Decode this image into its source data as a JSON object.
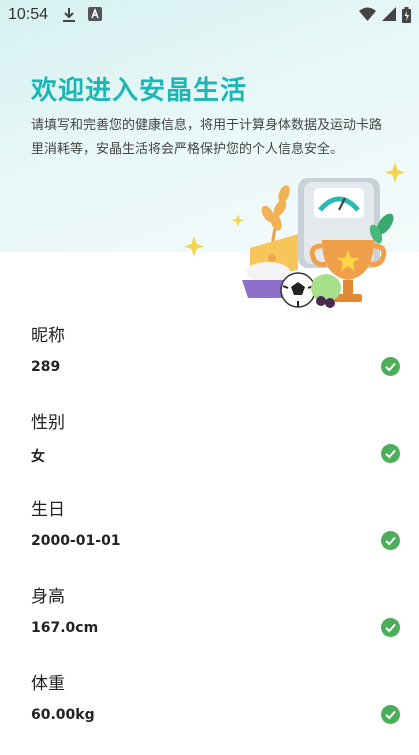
{
  "status_bar": {
    "time": "10:54"
  },
  "header": {
    "title": "欢迎进入安晶生活",
    "subtitle": "请填写和完善您的健康信息，将用于计算身体数据及运动卡路里消耗等，安晶生活将会严格保护您的个人信息安全。"
  },
  "fields": [
    {
      "label": "昵称",
      "value": "289"
    },
    {
      "label": "性别",
      "value": "女"
    },
    {
      "label": "生日",
      "value": "2000-01-01"
    },
    {
      "label": "身高",
      "value": "167.0cm"
    },
    {
      "label": "体重",
      "value": "60.00kg"
    }
  ],
  "colors": {
    "accent": "#1bb7b5",
    "check": "#4cae5a",
    "hero_bg": "#dff4f4"
  },
  "icons": [
    "download-icon",
    "a-icon",
    "wifi-icon",
    "signal-icon",
    "battery-icon",
    "check-circle-icon"
  ]
}
